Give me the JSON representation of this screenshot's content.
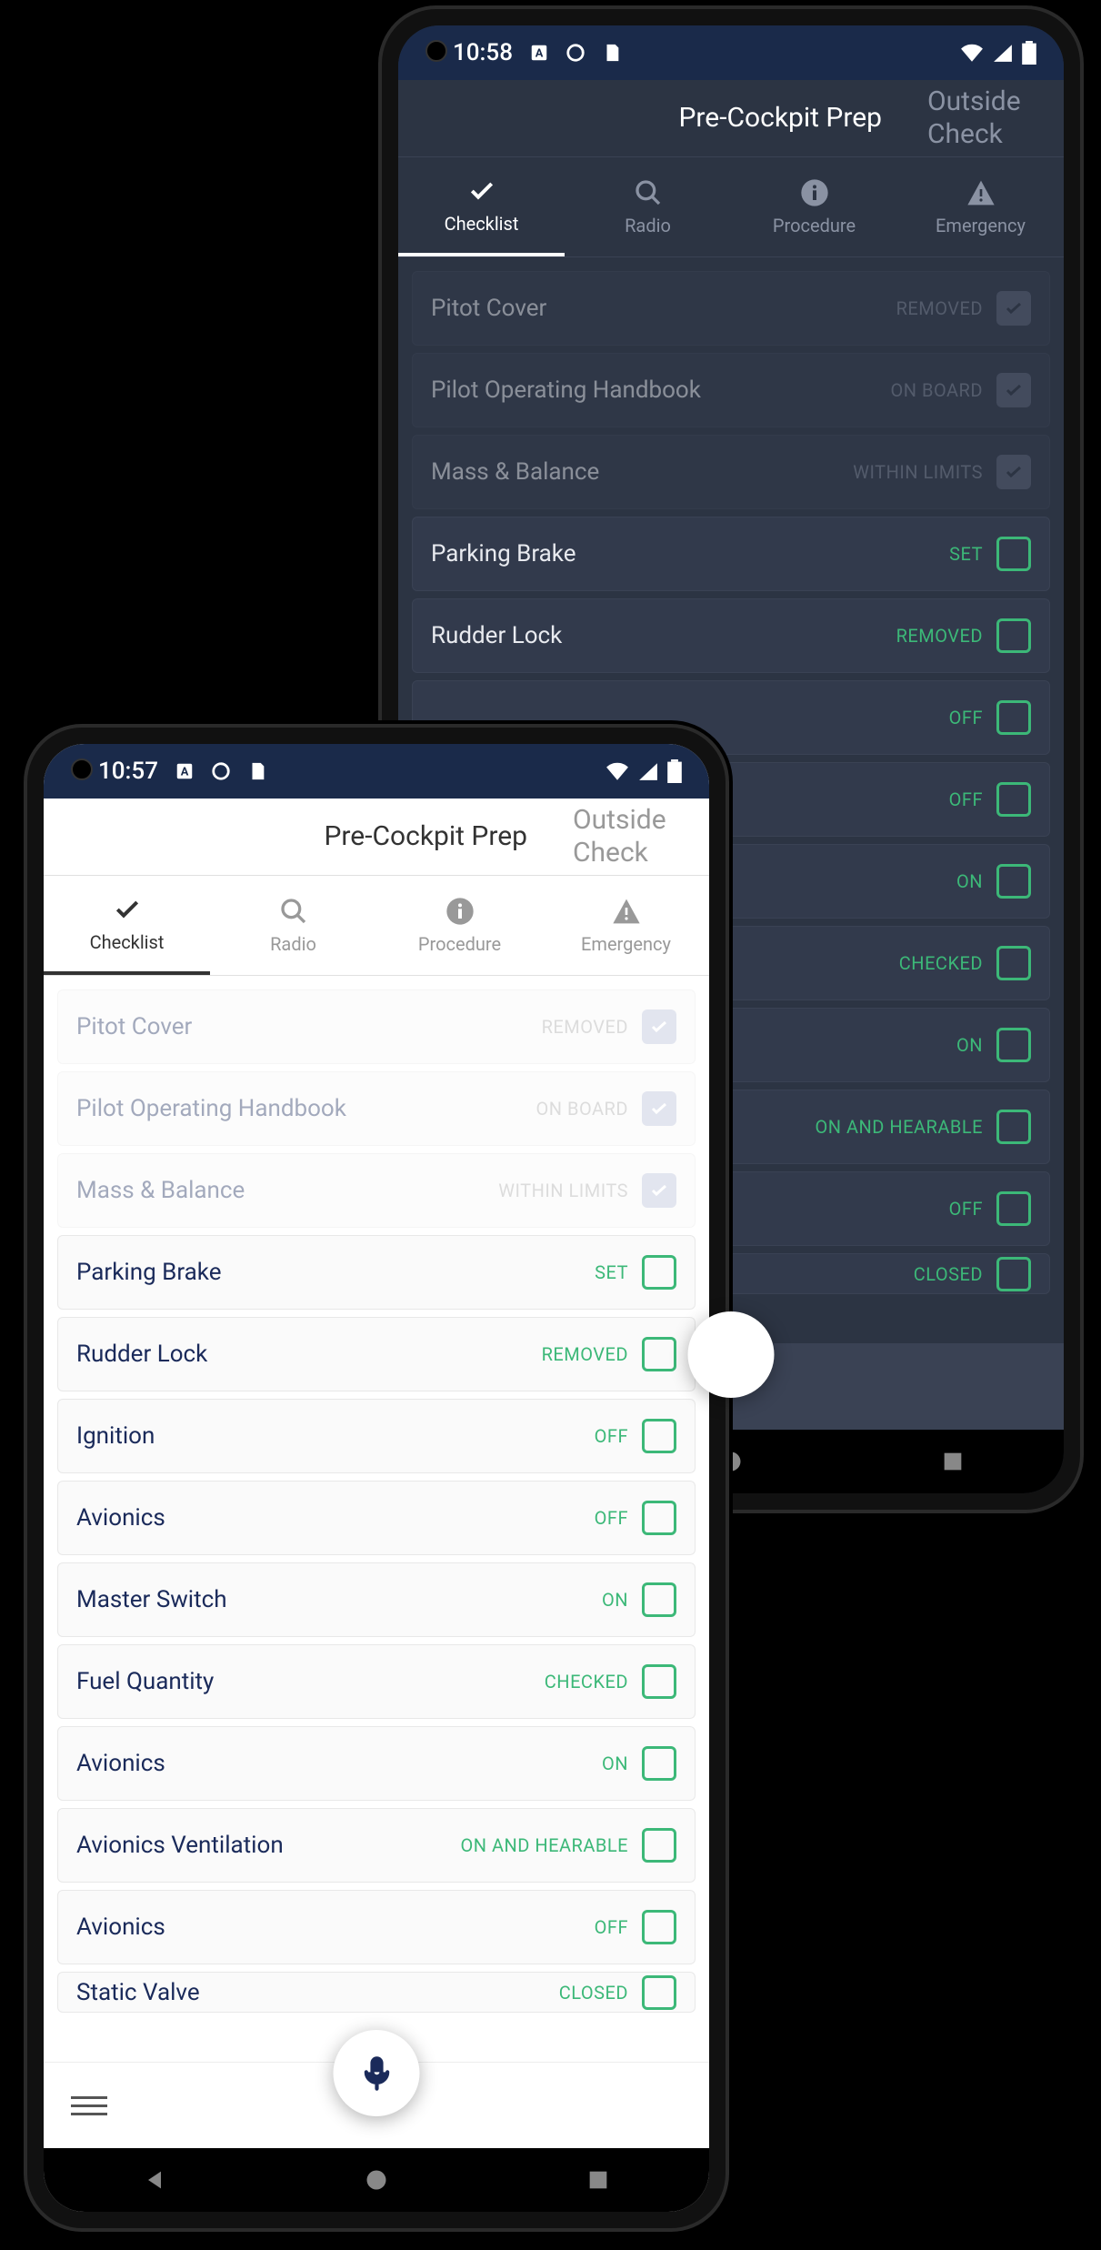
{
  "dark": {
    "statusbar": {
      "time": "10:58"
    },
    "header": {
      "tab_active": "Pre-Cockpit Prep",
      "tab_inactive": "Outside Check"
    },
    "sections": [
      {
        "label": "Checklist",
        "icon": "check",
        "active": true
      },
      {
        "label": "Radio",
        "icon": "search",
        "active": false
      },
      {
        "label": "Procedure",
        "icon": "info",
        "active": false
      },
      {
        "label": "Emergency",
        "icon": "warning",
        "active": false
      }
    ],
    "items": [
      {
        "label": "Pitot Cover",
        "status": "REMOVED",
        "checked": true
      },
      {
        "label": "Pilot Operating Handbook",
        "status": "ON BOARD",
        "checked": true
      },
      {
        "label": "Mass & Balance",
        "status": "WITHIN LIMITS",
        "checked": true
      },
      {
        "label": "Parking Brake",
        "status": "SET",
        "checked": false
      },
      {
        "label": "Rudder Lock",
        "status": "REMOVED",
        "checked": false
      },
      {
        "label": "",
        "status": "OFF",
        "checked": false
      },
      {
        "label": "",
        "status": "OFF",
        "checked": false
      },
      {
        "label": "",
        "status": "ON",
        "checked": false
      },
      {
        "label": "",
        "status": "CHECKED",
        "checked": false
      },
      {
        "label": "",
        "status": "ON",
        "checked": false
      },
      {
        "label": "",
        "status": "ON AND HEARABLE",
        "checked": false
      },
      {
        "label": "",
        "status": "OFF",
        "checked": false
      },
      {
        "label": "",
        "status": "CLOSED",
        "checked": false
      }
    ]
  },
  "light": {
    "statusbar": {
      "time": "10:57"
    },
    "header": {
      "tab_active": "Pre-Cockpit Prep",
      "tab_inactive": "Outside Check"
    },
    "sections": [
      {
        "label": "Checklist",
        "icon": "check",
        "active": true
      },
      {
        "label": "Radio",
        "icon": "search",
        "active": false
      },
      {
        "label": "Procedure",
        "icon": "info",
        "active": false
      },
      {
        "label": "Emergency",
        "icon": "warning",
        "active": false
      }
    ],
    "items": [
      {
        "label": "Pitot Cover",
        "status": "REMOVED",
        "checked": true
      },
      {
        "label": "Pilot Operating Handbook",
        "status": "ON BOARD",
        "checked": true
      },
      {
        "label": "Mass & Balance",
        "status": "WITHIN LIMITS",
        "checked": true
      },
      {
        "label": "Parking Brake",
        "status": "SET",
        "checked": false
      },
      {
        "label": "Rudder Lock",
        "status": "REMOVED",
        "checked": false
      },
      {
        "label": "Ignition",
        "status": "OFF",
        "checked": false
      },
      {
        "label": "Avionics",
        "status": "OFF",
        "checked": false
      },
      {
        "label": "Master Switch",
        "status": "ON",
        "checked": false
      },
      {
        "label": "Fuel Quantity",
        "status": "CHECKED",
        "checked": false
      },
      {
        "label": "Avionics",
        "status": "ON",
        "checked": false
      },
      {
        "label": "Avionics Ventilation",
        "status": "ON AND HEARABLE",
        "checked": false
      },
      {
        "label": "Avionics",
        "status": "OFF",
        "checked": false
      },
      {
        "label": "Static Valve",
        "status": "CLOSED",
        "checked": false
      }
    ]
  }
}
